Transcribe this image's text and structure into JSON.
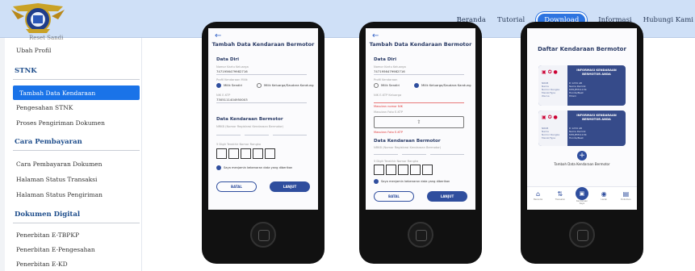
{
  "header": {
    "nav": [
      {
        "label": "Beranda"
      },
      {
        "label": "Tutorial"
      },
      {
        "label": "Download"
      },
      {
        "label": "Informasi"
      },
      {
        "label": "Hubungi Kami"
      }
    ],
    "active_nav": "Download",
    "accent_color": "#2d74e0",
    "bg_color": "#cfe0f7"
  },
  "sidebar": {
    "cut_item": "Reset Sandi",
    "profile_item": "Ubah Profil",
    "sections": [
      {
        "heading": "STNK",
        "items": [
          "Tambah Data Kendaraan",
          "Pengesahan STNK",
          "Proses Pengiriman Dokumen"
        ],
        "active": "Tambah Data Kendaraan"
      },
      {
        "heading": "Cara Pembayaran",
        "items": [
          "Cara Pembayaran Dokumen",
          "Halaman Status Transaksi",
          "Halaman Status Pengiriman"
        ]
      },
      {
        "heading": "Dokumen Digital",
        "items": [
          "Penerbitan E-TBPKP",
          "Penerbitan E-Pengesahan",
          "Penerbitan E-KD"
        ]
      }
    ]
  },
  "phone1": {
    "back": "←",
    "title": "Tambah Data Kendaraan Bermotor",
    "sec_diri": "Data Diri",
    "lbl_kk": "Nomor Kartu Keluarga",
    "val_kk": "7471956479982716",
    "lbl_profil": "Profil Kendaraan Milik",
    "radio_sendiri": "Milik Sendiri",
    "radio_keluarga": "Milik Keluarga/Saudara Kandung",
    "lbl_nik": "NIK E-KTP",
    "val_nik": "7305111404950003",
    "sec_kendaraan": "Data Kendaraan Bermotor",
    "lbl_nrkb": "NRKB (Nomor Registrasi Kendaraan Bermotor)",
    "lbl_rangka": "5 Digit Terakhir Nomor Rangka",
    "check_label": "Saya menjamin kebenaran data yang diberikan",
    "btn_cancel": "BATAL",
    "btn_next": "LANJUT"
  },
  "phone2": {
    "back": "←",
    "title": "Tambah Data Kendaraan Bermotor",
    "sec_diri": "Data Diri",
    "lbl_kk": "Nomor Kartu Keluarga",
    "val_kk": "7471956479982716",
    "lbl_profil": "Profil Kendaraan",
    "radio_sendiri": "Milik Sendiri",
    "radio_keluarga": "Milik Keluarga/Saudara Kandung",
    "lbl_nik": "NIK E-KTP Keluarga",
    "err_nik": "Masukan nomor NIK",
    "lbl_foto": "Masukan Foto E-KTP",
    "err_foto": "Masukan Foto E-KTP",
    "upload_icon": "⇪",
    "sec_kendaraan": "Data Kendaraan Bermotor",
    "lbl_nrkb": "NRKB (Nomor Registrasi Kendaraan Bermotor)",
    "lbl_rangka": "5 Digit Terakhir Nomor Rangka",
    "check_label": "Saya menjamin kebenaran data yang diberikan",
    "btn_cancel": "BATAL",
    "btn_next": "LANJUT"
  },
  "phone3": {
    "title": "Daftar Kendaraan Bermotor",
    "card1_title": "INFORMASI KENDARAAN BERMOTOR ANDA",
    "card2_title": "INFORMASI KENDARAAN BERMOTOR ANDA",
    "card_rows": [
      {
        "k": "NRKB",
        "v": "D 1234 AB"
      },
      {
        "k": "Nama",
        "v": "Nama Pemilik"
      },
      {
        "k": "Nomor Rangka",
        "v": "MH1JFM1113K"
      },
      {
        "k": "Merek/Type",
        "v": "Honda/Beat"
      },
      {
        "k": "Warna",
        "v": "Hitam"
      }
    ],
    "add_icon": "+",
    "add_label": "Tambah Data Kendaraan Bermotor",
    "bottom_nav": [
      {
        "icon": "⌂",
        "label": "Beranda"
      },
      {
        "icon": "⇅",
        "label": "Transaksi"
      },
      {
        "icon": "▣",
        "label": "Kendaraan Saya"
      },
      {
        "icon": "◉",
        "label": "Lacak"
      },
      {
        "icon": "▤",
        "label": "Dokumen"
      }
    ]
  }
}
